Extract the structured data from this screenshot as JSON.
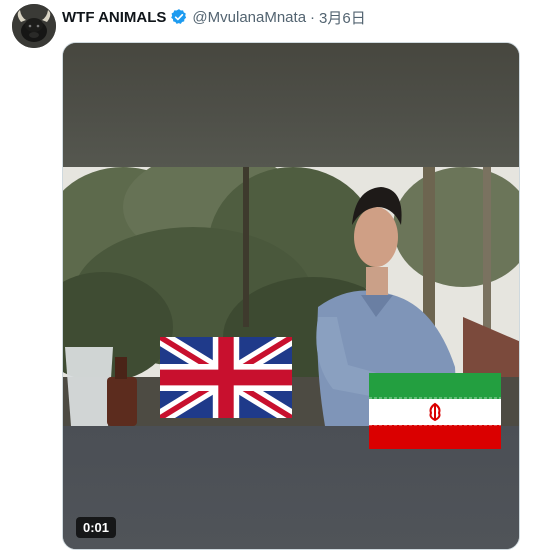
{
  "tweet": {
    "display_name": "WTF ANIMALS",
    "handle": "@MvulanaMnata",
    "separator": "·",
    "date": "3月6日",
    "verified_color": "#1d9bf0"
  },
  "media": {
    "type": "video",
    "timestamp": "0:01",
    "overlays": [
      "uk-flag",
      "iran-flag"
    ]
  },
  "icons": {
    "verified": "verified-badge-icon",
    "avatar": "bull-avatar"
  }
}
